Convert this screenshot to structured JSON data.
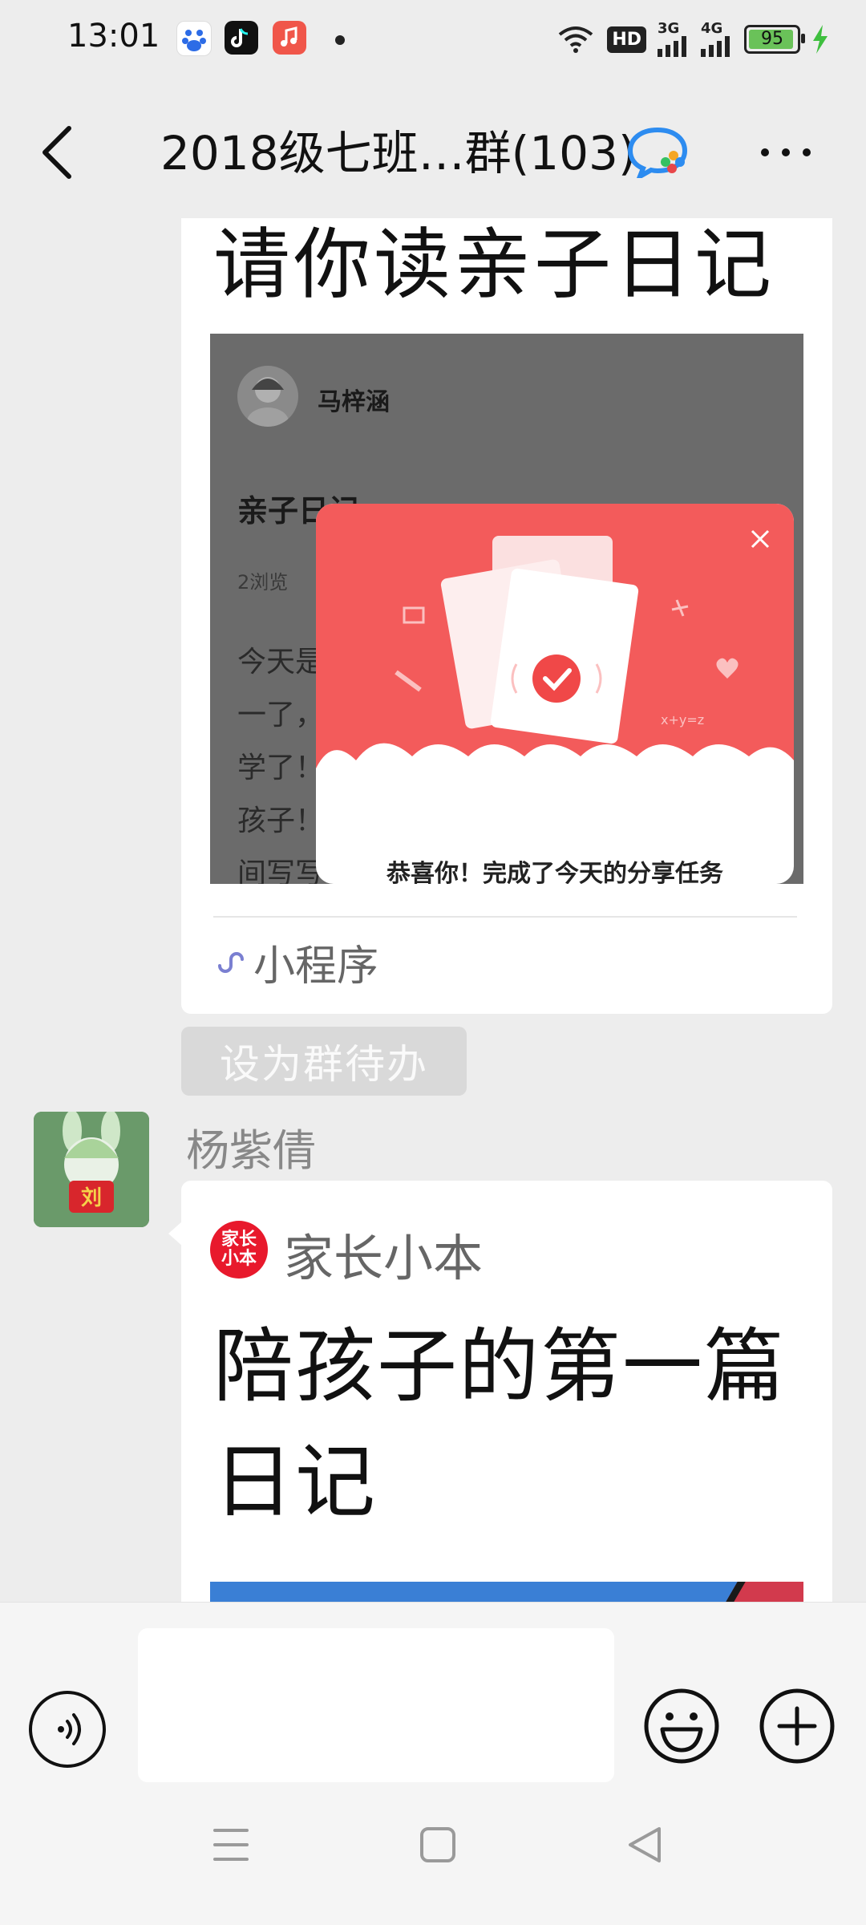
{
  "status_bar": {
    "time": "13:01",
    "network_3g": "3G",
    "network_4g": "4G",
    "hd_label": "HD",
    "battery_percent": 95,
    "battery_text": "95",
    "charging": true
  },
  "nav": {
    "title": "2018级七班…群(103)",
    "back_icon": "chevron-left-icon",
    "more_icon": "more-dots-icon"
  },
  "messages": [
    {
      "type": "mini_program_card",
      "title": "请你读亲子日记",
      "thumbnail": {
        "author": "马梓涵",
        "diary_title": "亲子日记",
        "views": "2浏览",
        "text_lines": [
          "今天是",
          "一了，",
          "学了！",
          "孩子！",
          "间写写"
        ],
        "popup_text": "恭喜你！完成了今天的分享任务"
      },
      "source_label": "小程序",
      "action_button": "设为群待办"
    },
    {
      "type": "article_card",
      "sender": "杨紫倩",
      "avatar_badge": "刘",
      "source_logo_text": [
        "家长",
        "小本"
      ],
      "source_name": "家长小本",
      "title": "陪孩子的第一篇日记"
    }
  ],
  "input_bar": {
    "voice_icon": "voice-icon",
    "input_value": "",
    "emoji_icon": "emoji-icon",
    "plus_icon": "plus-icon"
  },
  "system_nav": [
    "menu-icon",
    "home-icon",
    "back-triangle-icon"
  ],
  "colors": {
    "background": "#ededed",
    "card": "#ffffff",
    "popup_red": "#f35b5b",
    "battery_green": "#6ac259",
    "logo_red": "#e8192c"
  }
}
